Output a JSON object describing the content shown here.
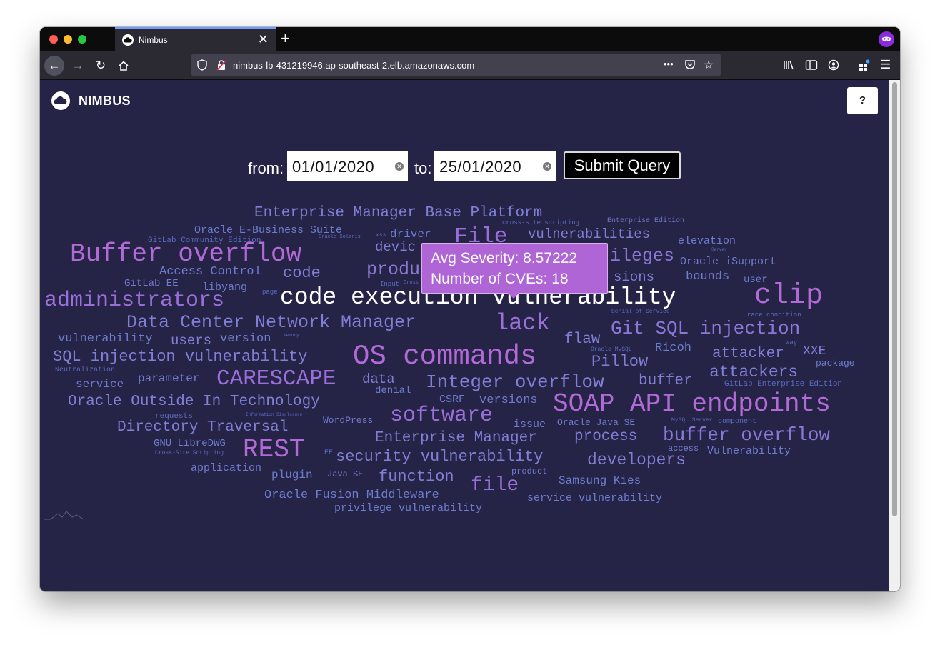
{
  "browser": {
    "tab_title": "Nimbus",
    "url": "nimbus-lb-431219946.ap-southeast-2.elb.amazonaws.com",
    "page_actions_label": "•••",
    "new_tab_label": "+",
    "close_tab_label": "✕"
  },
  "app": {
    "name": "NIMBUS",
    "help_label": "?"
  },
  "query": {
    "from_label": "from:",
    "from_value": "01/01/2020",
    "to_label": "to:",
    "to_value": "25/01/2020",
    "submit_label": "Submit Query"
  },
  "tooltip": {
    "line1": "Avg Severity: 8.57222",
    "line2": "Number of CVEs: 18"
  },
  "colors": {
    "background": "#252346",
    "word_low": "#5a6bc0",
    "word_mid": "#7f7fd5",
    "word_high": "#b26ad6",
    "word_active": "#ffffff"
  },
  "word_cloud": [
    {
      "text": "Enterprise Manager Base Platform"
    },
    {
      "text": "Enterprise Edition"
    },
    {
      "text": "cross-site scripting"
    },
    {
      "text": "Oracle E-Business Suite"
    },
    {
      "text": "File"
    },
    {
      "text": "vulnerabilities"
    },
    {
      "text": "GitLab Community Edition"
    },
    {
      "text": "Oracle Solaris"
    },
    {
      "text": "xss"
    },
    {
      "text": "driver"
    },
    {
      "text": "elevation"
    },
    {
      "text": "Buffer overflow"
    },
    {
      "text": "devic"
    },
    {
      "text": "ileges"
    },
    {
      "text": "Server"
    },
    {
      "text": "Oracle iSupport"
    },
    {
      "text": "Access Control"
    },
    {
      "text": "code"
    },
    {
      "text": "produ"
    },
    {
      "text": "sions"
    },
    {
      "text": "bounds"
    },
    {
      "text": "user"
    },
    {
      "text": "GitLab EE"
    },
    {
      "text": "libyang"
    },
    {
      "text": "Input"
    },
    {
      "text": "Cross"
    },
    {
      "text": "page"
    },
    {
      "text": "administrators"
    },
    {
      "text": "code execution vulnerability"
    },
    {
      "text": "clip"
    },
    {
      "text": "Denial of Service"
    },
    {
      "text": "race condition"
    },
    {
      "text": "Data Center Network Manager"
    },
    {
      "text": "lack"
    },
    {
      "text": "Git SQL injection"
    },
    {
      "text": "vulnerability"
    },
    {
      "text": "users"
    },
    {
      "text": "version"
    },
    {
      "text": "memory"
    },
    {
      "text": "flaw"
    },
    {
      "text": "way"
    },
    {
      "text": "Ricoh"
    },
    {
      "text": "Oracle MySQL"
    },
    {
      "text": "attacker"
    },
    {
      "text": "XXE"
    },
    {
      "text": "SQL injection vulnerability"
    },
    {
      "text": "OS commands"
    },
    {
      "text": "Pillow"
    },
    {
      "text": "package"
    },
    {
      "text": "Neutralization"
    },
    {
      "text": "attackers"
    },
    {
      "text": "parameter"
    },
    {
      "text": "CARESCAPE"
    },
    {
      "text": "data"
    },
    {
      "text": "Integer overflow"
    },
    {
      "text": "buffer"
    },
    {
      "text": "service"
    },
    {
      "text": "denial"
    },
    {
      "text": "GitLab Enterprise Edition"
    },
    {
      "text": "Oracle Outside In Technology"
    },
    {
      "text": "CSRF"
    },
    {
      "text": "versions"
    },
    {
      "text": "SOAP API endpoints"
    },
    {
      "text": "requests"
    },
    {
      "text": "Information Disclosure"
    },
    {
      "text": "software"
    },
    {
      "text": "WordPress"
    },
    {
      "text": "issue"
    },
    {
      "text": "Oracle Java SE"
    },
    {
      "text": "MySQL Server"
    },
    {
      "text": "component"
    },
    {
      "text": "Directory Traversal"
    },
    {
      "text": "Enterprise Manager"
    },
    {
      "text": "process"
    },
    {
      "text": "buffer overflow"
    },
    {
      "text": "GNU LibreDWG"
    },
    {
      "text": "access"
    },
    {
      "text": "Cross-Site Scripting"
    },
    {
      "text": "REST"
    },
    {
      "text": "EE"
    },
    {
      "text": "security vulnerability"
    },
    {
      "text": "Vulnerability"
    },
    {
      "text": "developers"
    },
    {
      "text": "application"
    },
    {
      "text": "product"
    },
    {
      "text": "plugin"
    },
    {
      "text": "Java SE"
    },
    {
      "text": "function"
    },
    {
      "text": "Samsung Kies"
    },
    {
      "text": "file"
    },
    {
      "text": "Oracle Fusion Middleware"
    },
    {
      "text": "service vulnerability"
    },
    {
      "text": "privilege vulnerability"
    }
  ]
}
